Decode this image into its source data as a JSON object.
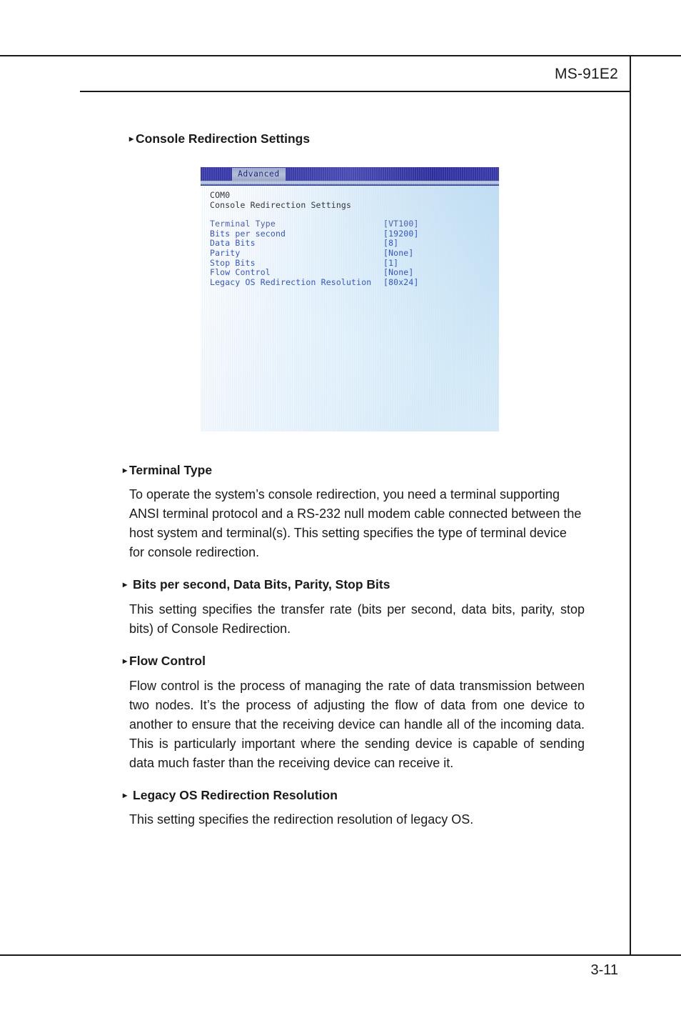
{
  "page": {
    "header_title": "MS-91E2",
    "footer_page_number": "3-11",
    "bullet_glyph": "▸"
  },
  "colors": {
    "text": "#1a1a1a",
    "bios_text_blue": "#3355cc",
    "bios_tab_blue": "#3535a4",
    "rule": "#1a1a1a"
  },
  "main_heading": "Console Redirection Settings",
  "bios_screenshot": {
    "tab_label": "Advanced",
    "header_lines": [
      "COM0",
      "Console Redirection Settings"
    ],
    "settings": [
      {
        "label": "Terminal Type",
        "value": "[VT100]"
      },
      {
        "label": "Bits per second",
        "value": "[19200]"
      },
      {
        "label": "Data Bits",
        "value": "[8]"
      },
      {
        "label": "Parity",
        "value": "[None]"
      },
      {
        "label": "Stop Bits",
        "value": "[1]"
      },
      {
        "label": "Flow Control",
        "value": "[None]"
      },
      {
        "label": "Legacy OS Redirection Resolution",
        "value": "[80x24]"
      }
    ]
  },
  "sections": [
    {
      "heading": "Terminal Type",
      "body": "To operate the system’s console redirection, you need a terminal supporting ANSI terminal protocol and a RS-232 null modem cable connected between the host system and terminal(s). This setting specifies the type of terminal device for console redirection."
    },
    {
      "heading": "Bits per second, Data Bits, Parity, Stop Bits",
      "body": "This setting specifies the transfer rate (bits per second, data bits, parity, stop bits) of Console Redirection."
    },
    {
      "heading": "Flow Control",
      "body": "Flow control is the process of managing the rate of data transmission between two nodes. It’s the process of adjusting the flow of data from one device to another to ensure that the receiving device can handle all of the incoming data. This is particularly important where the sending device is capable of sending data much faster than the receiving device can receive it."
    },
    {
      "heading": "Legacy OS Redirection Resolution",
      "body": "This setting specifies the redirection resolution of legacy OS."
    }
  ]
}
